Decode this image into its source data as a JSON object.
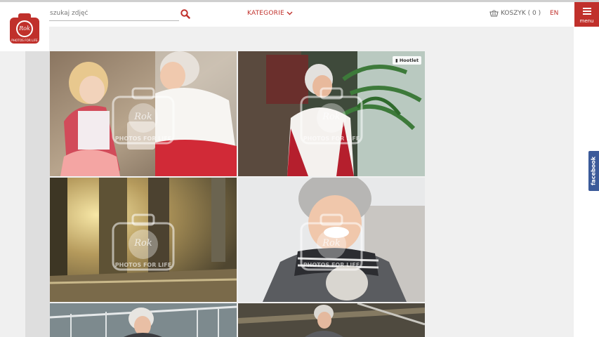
{
  "header": {
    "logo_alt": "Rok Rocco Photos For Life",
    "logo_text_top": "Rok",
    "logo_text_bottom": "PHOTOS FOR LIFE",
    "search_placeholder": "szukaj zdjęć",
    "search_icon": "search-icon",
    "categories_label": "KATEGORIE",
    "categories_icon": "chevron-down-icon",
    "cart_label": "KOSZYK ( 0 )",
    "cart_icon": "basket-icon",
    "language_label": "EN",
    "menu_label": "menu",
    "menu_icon": "hamburger-icon"
  },
  "gallery": {
    "watermark_top": "Rok",
    "watermark_bottom": "PHOTOS FOR LIFE",
    "hootlet_label": "Hootlet",
    "photos": [
      "girl-with-grandmother-opening-gift",
      "senior-woman-laughing-by-window",
      "sunlit-tree-in-park",
      "senior-woman-in-winter-scarf-laughing",
      "senior-woman-by-railing",
      "senior-woman-on-steps"
    ]
  },
  "social": {
    "facebook_label": "facebook"
  },
  "colors": {
    "brand_red": "#c0302b",
    "facebook_blue": "#3b5a99"
  }
}
